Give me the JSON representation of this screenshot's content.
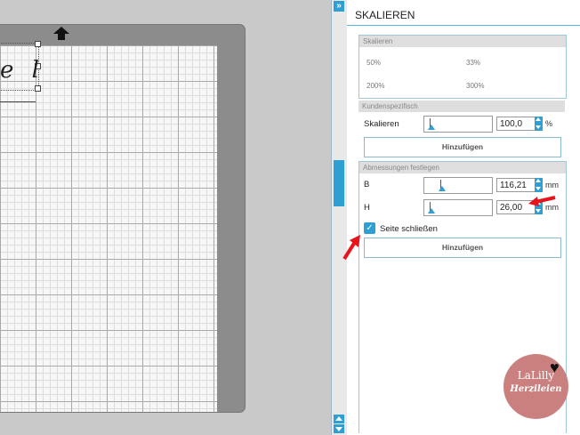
{
  "canvas": {
    "design_text": "e l"
  },
  "panel": {
    "title": "SKALIEREN",
    "scale_section": {
      "header": "Skalieren",
      "presets": [
        "50%",
        "33%",
        "200%",
        "300%"
      ]
    },
    "custom_section": {
      "header": "Kundenspezifisch",
      "label": "Skalieren",
      "value": "100,0",
      "unit": "%",
      "button": "Hinzufügen"
    },
    "dimensions_section": {
      "header": "Abmessungen festlegen",
      "width_label": "B",
      "width_value": "116,21",
      "height_label": "H",
      "height_value": "26,00",
      "unit": "mm",
      "lock_label": "Seite schließen",
      "lock_checked": true,
      "button": "Hinzufügen"
    }
  },
  "logo": {
    "line1": "LaLilly",
    "line2": "Herzileien"
  },
  "colors": {
    "accent": "#2e9fd2",
    "annotation_arrow": "#e8141c"
  }
}
